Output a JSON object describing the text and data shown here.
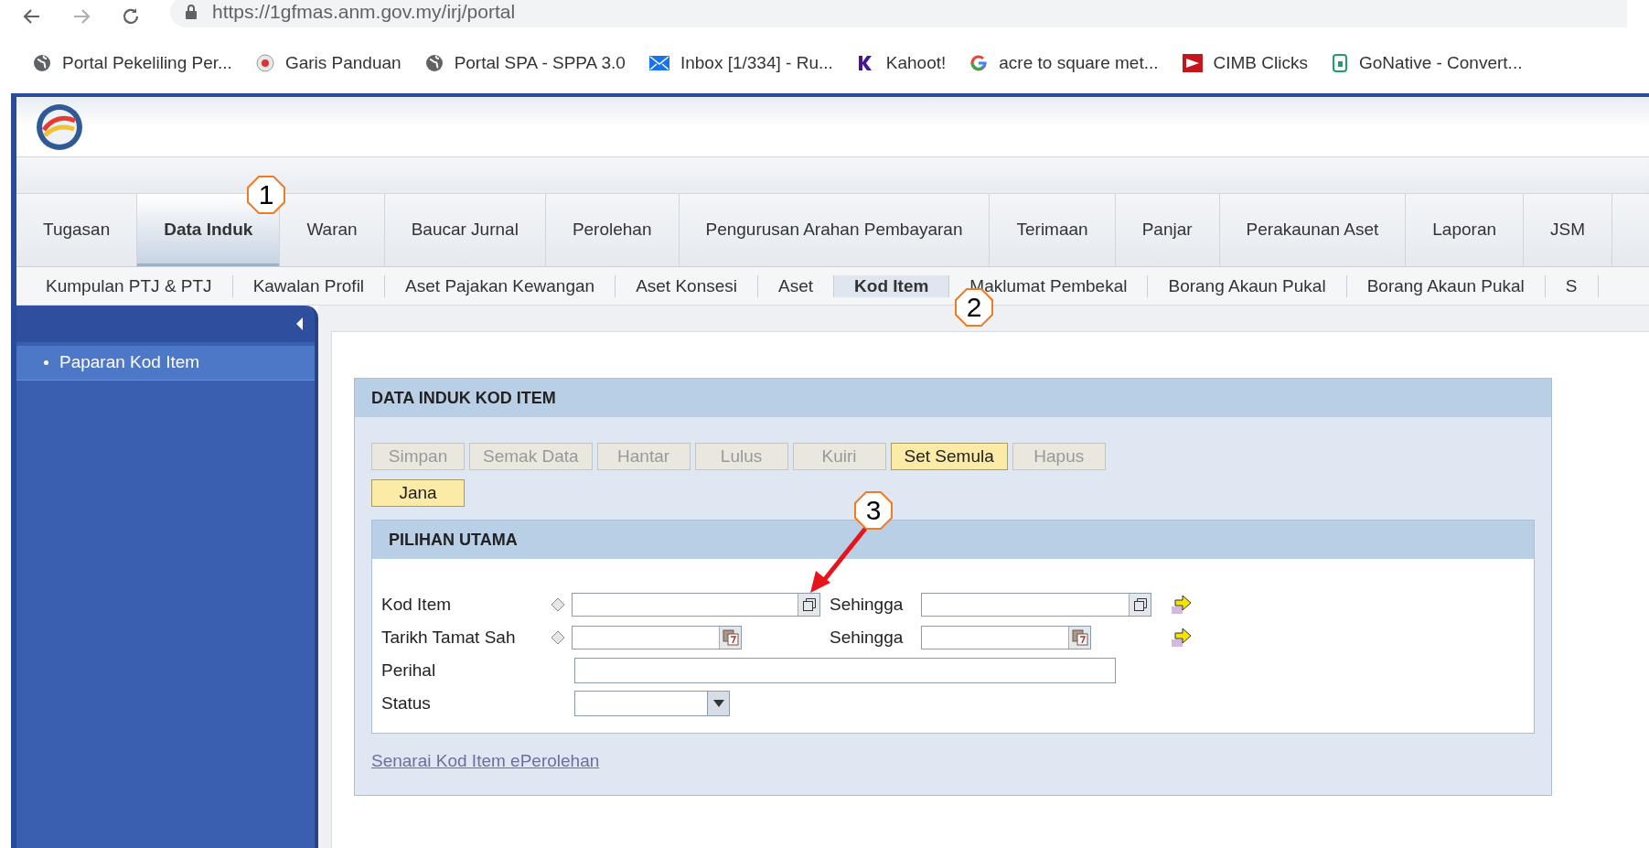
{
  "browser": {
    "url": "https://1gfmas.anm.gov.my/irj/portal",
    "bookmarks": [
      {
        "label": "Portal Pekeliling Per...",
        "kind": "globe"
      },
      {
        "label": "Garis Panduan",
        "kind": "seal"
      },
      {
        "label": "Portal SPA - SPPA 3.0",
        "kind": "globe"
      },
      {
        "label": "Inbox [1/334] - Ru...",
        "kind": "mail"
      },
      {
        "label": "Kahoot!",
        "kind": "kahoot"
      },
      {
        "label": "acre to square met...",
        "kind": "google"
      },
      {
        "label": "CIMB Clicks",
        "kind": "cimb"
      },
      {
        "label": "GoNative - Convert...",
        "kind": "app"
      }
    ]
  },
  "main_tabs": [
    {
      "label": "Tugasan",
      "selected": false
    },
    {
      "label": "Data Induk",
      "selected": true
    },
    {
      "label": "Waran",
      "selected": false
    },
    {
      "label": "Baucar Jurnal",
      "selected": false
    },
    {
      "label": "Perolehan",
      "selected": false
    },
    {
      "label": "Pengurusan Arahan Pembayaran",
      "selected": false
    },
    {
      "label": "Terimaan",
      "selected": false
    },
    {
      "label": "Panjar",
      "selected": false
    },
    {
      "label": "Perakaunan Aset",
      "selected": false
    },
    {
      "label": "Laporan",
      "selected": false
    },
    {
      "label": "JSM",
      "selected": false
    }
  ],
  "sub_tabs": [
    {
      "label": "Kumpulan PTJ & PTJ",
      "selected": false
    },
    {
      "label": "Kawalan Profil",
      "selected": false
    },
    {
      "label": "Aset Pajakan Kewangan",
      "selected": false
    },
    {
      "label": "Aset Konsesi",
      "selected": false
    },
    {
      "label": "Aset",
      "selected": false
    },
    {
      "label": "Kod Item",
      "selected": true
    },
    {
      "label": "Maklumat Pembekal",
      "selected": false
    },
    {
      "label": "Borang Akaun Pukal",
      "selected": false
    },
    {
      "label": "Borang Akaun Pukal",
      "selected": false
    },
    {
      "label": "S",
      "selected": false
    }
  ],
  "sidebar": {
    "items": [
      {
        "label": "Paparan Kod Item",
        "selected": true
      }
    ]
  },
  "panel": {
    "title": "DATA INDUK KOD ITEM",
    "buttons": [
      [
        {
          "label": "Simpan",
          "disabled": true
        },
        {
          "label": "Semak Data",
          "disabled": true
        },
        {
          "label": "Hantar",
          "disabled": true
        },
        {
          "label": "Lulus",
          "disabled": true
        },
        {
          "label": "Kuiri",
          "disabled": true
        },
        {
          "label": "Set Semula",
          "disabled": false
        },
        {
          "label": "Hapus",
          "disabled": true
        }
      ],
      [
        {
          "label": "Jana",
          "disabled": false
        }
      ]
    ],
    "section": {
      "title": "PILIHAN UTAMA",
      "rows": [
        {
          "kind": "range",
          "label": "Kod Item",
          "picker": {
            "kind": "copy"
          },
          "to_label": "Sehingga"
        },
        {
          "kind": "range",
          "label": "Tarikh Tamat Sah",
          "picker": {
            "kind": "calendar"
          },
          "to_label": "Sehingga"
        },
        {
          "kind": "text",
          "label": "Perihal"
        },
        {
          "kind": "select",
          "label": "Status"
        }
      ]
    },
    "link": "Senarai Kod Item ePerolehan"
  },
  "annotations": [
    "1",
    "2",
    "3"
  ]
}
